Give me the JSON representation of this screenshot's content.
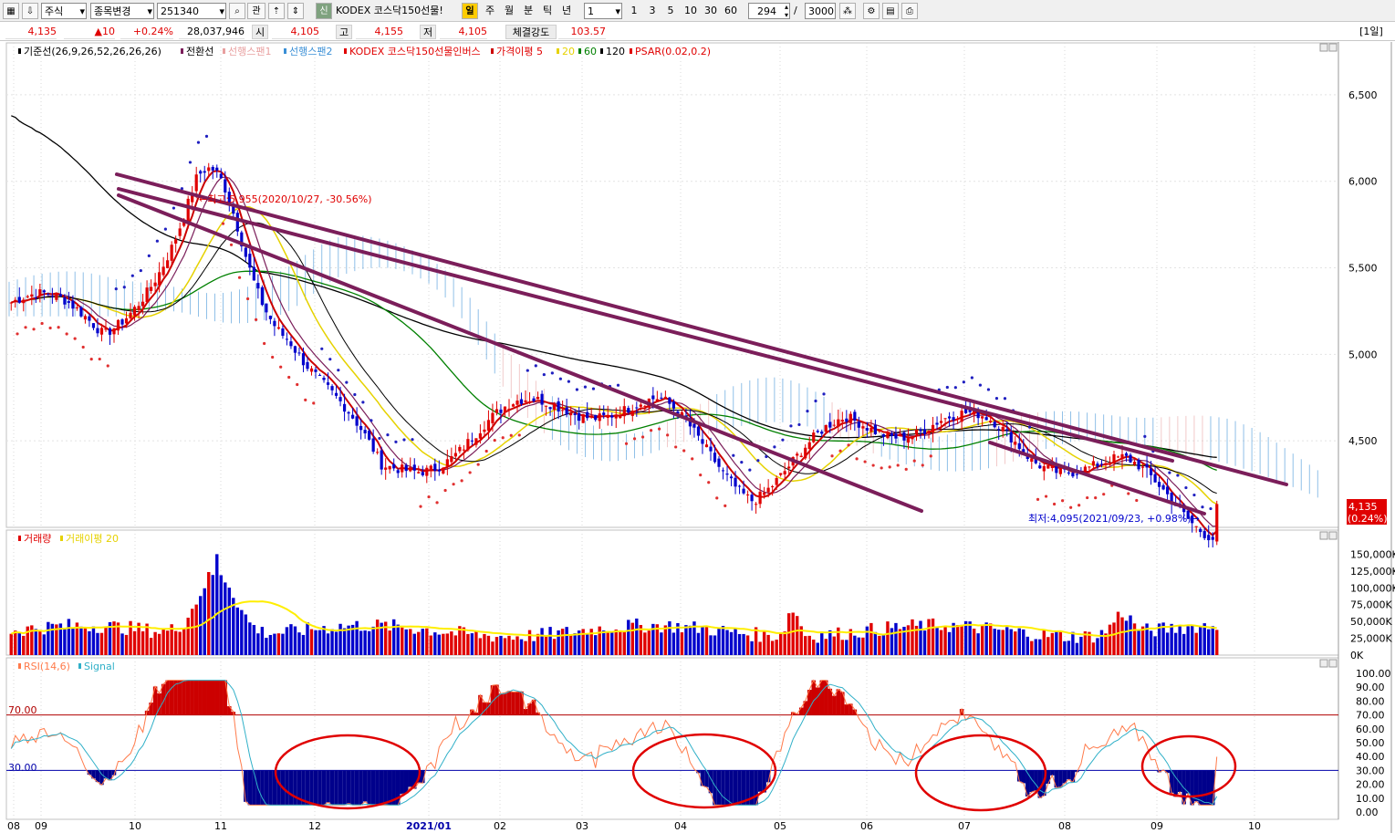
{
  "toolbar": {
    "market_type": "주식",
    "change_item_label": "종목변경",
    "code": "251340",
    "related_label": "관",
    "credit_badge": "신",
    "stock_name": "KODEX 코스닥150선물!",
    "period_active": "일",
    "periods": [
      "주",
      "월",
      "분",
      "틱",
      "년"
    ],
    "interval_value": "1",
    "quick_intervals": [
      "1",
      "3",
      "5",
      "10",
      "30",
      "60"
    ],
    "visible_count": "294",
    "total_count": "3000",
    "right_label": "[1일]"
  },
  "quote": {
    "price": "4,135",
    "change": "▲10",
    "change_pct": "+0.24%",
    "volume": "28,037,946",
    "open_label": "시",
    "open": "4,105",
    "high_label": "고",
    "high": "4,155",
    "low_label": "저",
    "low": "4,105",
    "strength_label": "체결강도",
    "strength": "103.57"
  },
  "legend": {
    "kijun": "기준선(26,9,26,52,26,26,26)",
    "tenkan": "전환선",
    "span1": "선행스팬1",
    "span2": "선행스팬2",
    "price": "KODEX 코스닥150선물인버스",
    "ma_label": "가격이평 5",
    "ma20": "20",
    "ma60": "60",
    "ma120": "120",
    "psar": "PSAR(0.02,0.2)",
    "volume": "거래량",
    "volume_ma": "거래이평 20",
    "rsi": "RSI(14,6)",
    "signal": "Signal"
  },
  "annotations": {
    "high": "←최고:5,955(2020/10/27, -30.56%)",
    "low": "최저:4,095(2021/09/23, +0.98%)→",
    "last_price": "4,135",
    "last_pct": "(0.24%)"
  },
  "colors": {
    "up": "#e00000",
    "down": "#0000cc",
    "ma5": "#cc0000",
    "ma20": "#e6d200",
    "ma60": "#008000",
    "ma120": "#000000",
    "trendline": "#7b1e5a",
    "span": "#3a8fd6",
    "span_up": "#e8a0a0",
    "rsi": "#ff7a4a",
    "signal": "#30b0c8"
  },
  "chart_data": [
    {
      "type": "candlestick",
      "x_ticks": [
        "08",
        "09",
        "10",
        "11",
        "12",
        "2021/01",
        "02",
        "03",
        "04",
        "05",
        "06",
        "07",
        "08",
        "09",
        "10"
      ],
      "y_ticks": [
        "6,500",
        "6,000",
        "5,500",
        "5,000",
        "4,500"
      ],
      "ylim": [
        4000,
        6800
      ],
      "monthly_close": [
        {
          "x": "2020/08",
          "y": 5300
        },
        {
          "x": "2020/09",
          "y": 5050
        },
        {
          "x": "2020/10",
          "y": 5600
        },
        {
          "x": "2020/11",
          "y": 5250
        },
        {
          "x": "2020/12",
          "y": 4400
        },
        {
          "x": "2021/01",
          "y": 4500
        },
        {
          "x": "2021/02",
          "y": 4600
        },
        {
          "x": "2021/03",
          "y": 4650
        },
        {
          "x": "2021/04",
          "y": 4350
        },
        {
          "x": "2021/05",
          "y": 4650
        },
        {
          "x": "2021/06",
          "y": 4550
        },
        {
          "x": "2021/07",
          "y": 4320
        },
        {
          "x": "2021/08",
          "y": 4350
        },
        {
          "x": "2021/09",
          "y": 4135
        }
      ],
      "last": {
        "open": 4105,
        "high": 4155,
        "low": 4105,
        "close": 4135
      }
    },
    {
      "type": "bar",
      "series": [
        {
          "name": "거래량"
        },
        {
          "name": "거래이평 20"
        }
      ],
      "y_ticks": [
        "150,000K",
        "125,000K",
        "100,000K",
        "75,000K",
        "50,000K",
        "25,000K",
        "0K"
      ],
      "ylim": [
        0,
        160000
      ],
      "peak": {
        "x": "2020/10",
        "y": 150000
      }
    },
    {
      "type": "line",
      "series": [
        {
          "name": "RSI(14,6)"
        },
        {
          "name": "Signal"
        }
      ],
      "y_ticks": [
        "100.00",
        "90.00",
        "80.00",
        "70.00",
        "60.00",
        "50.00",
        "40.00",
        "30.00",
        "20.00",
        "10.00",
        "0.00"
      ],
      "ylim": [
        0,
        100
      ],
      "levels": [
        {
          "label": "70.00",
          "y": 70
        },
        {
          "label": "30.00",
          "y": 30
        }
      ]
    }
  ]
}
